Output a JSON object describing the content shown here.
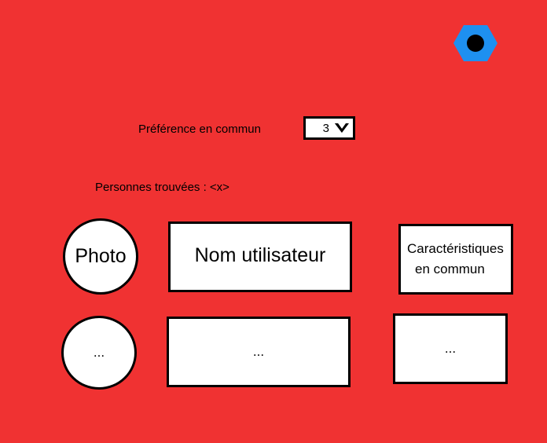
{
  "header": {
    "settings_icon": "hexagon-settings-icon",
    "accent_color": "#1e90f0"
  },
  "filter": {
    "label": "Préférence en commun",
    "selected_value": "3"
  },
  "results": {
    "count_label": "Personnes trouvées : <x>"
  },
  "rows": [
    {
      "photo": "Photo",
      "username": "Nom utilisateur",
      "traits_line1": "Caractéristiques",
      "traits_line2": "en commun"
    },
    {
      "photo": "...",
      "username": "...",
      "traits": "..."
    }
  ]
}
